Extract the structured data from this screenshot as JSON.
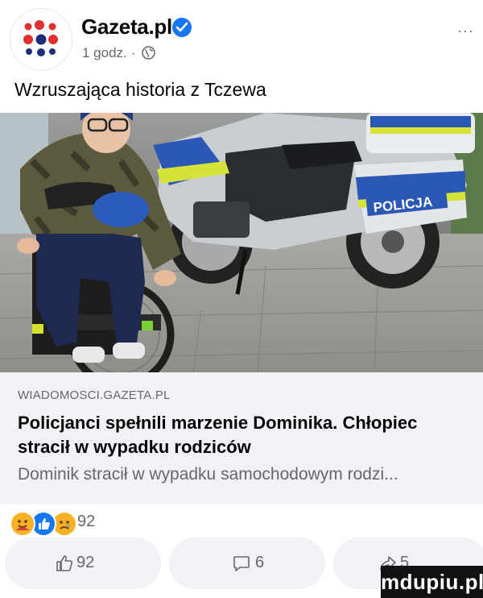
{
  "post": {
    "page_name": "Gazeta.pl",
    "time": "1 godz.",
    "separator": "·",
    "more": "···",
    "text": "Wzruszająca historia z Tczewa"
  },
  "link": {
    "domain": "WIADOMOSCI.GAZETA.PL",
    "title": "Policjanci spełnili marzenie Dominika. Chłopiec stracił w wypadku rodziców",
    "description": "Dominik stracił w wypadku samochodowym rodzi..."
  },
  "photo": {
    "police_label": "POLICJA"
  },
  "reactions": {
    "types": [
      "care",
      "like",
      "sad"
    ],
    "count": "92"
  },
  "actions": {
    "like_count": "92",
    "comment_count": "6",
    "share_count": "5"
  },
  "watermark": "mdupiu.pl",
  "colors": {
    "brand_red": "#e22f2f",
    "brand_blue": "#1f2e7a",
    "verified": "#1877f2",
    "like": "#1877f2",
    "care": "#f7b125",
    "secondary_text": "#65676b",
    "panel": "#f0f2f5"
  }
}
